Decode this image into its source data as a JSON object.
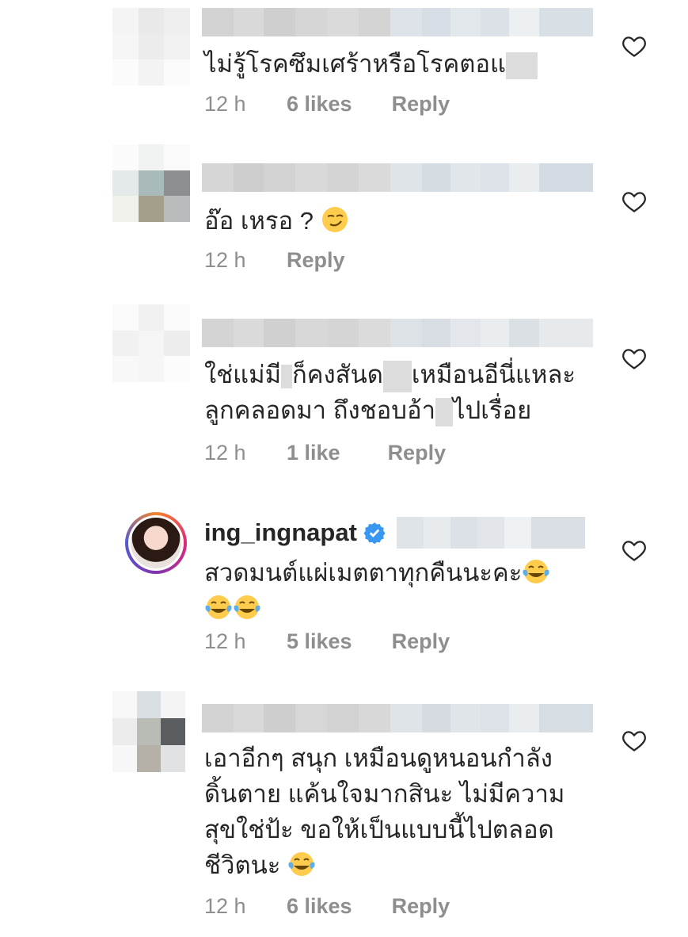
{
  "comments": [
    {
      "text": "ไม่รู้โรคซึมเศร้าหรือโรคตอแ",
      "time": "12 h",
      "likes": "6 likes",
      "reply": "Reply"
    },
    {
      "text": "อ๊อ เหรอ ?",
      "time": "12 h",
      "likes": "",
      "reply": "Reply"
    },
    {
      "text_line1a": "ใช่แม่มี",
      "text_line1b": "ก็คงสันด",
      "text_line1c": "เหมือนอีนี่แหละ",
      "text_line2a": "ลูกคลอดมา ถึงชอบอ้า",
      "text_line2b": "ไปเรื่อย",
      "time": "12 h",
      "likes": "1 like",
      "reply": "Reply"
    },
    {
      "username": "ing_ingnapat",
      "text": "สวดมนต์แผ่เมตตาทุกคืนนะคะ",
      "time": "12 h",
      "likes": "5 likes",
      "reply": "Reply"
    },
    {
      "line1": "เอาอีกๆ สนุก เหมือนดูหนอนกำลัง",
      "line2": "ดิ้นตาย แค้นใจมากสินะ ไม่มีความ",
      "line3": "สุขใช่ป้ะ ขอให้เป็นแบบนี้ไปตลอด",
      "line4": "ชีวิตนะ",
      "time": "12 h",
      "likes": "6 likes",
      "reply": "Reply"
    }
  ],
  "icons": {
    "heart": "heart-outline-icon",
    "verified": "verified-badge-icon",
    "emoji_smirk": "smirking-face-emoji",
    "emoji_laugh": "face-with-tears-of-joy-emoji"
  },
  "colors": {
    "text": "#262626",
    "meta": "#8e8e8e",
    "verified": "#3897f0"
  }
}
